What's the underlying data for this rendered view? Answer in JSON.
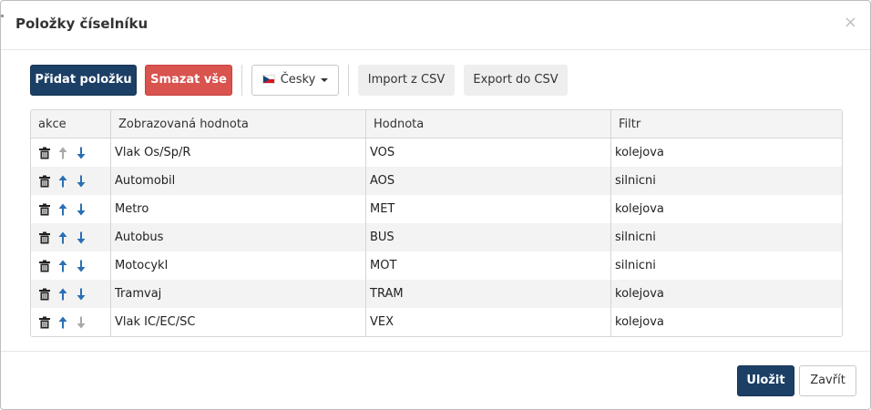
{
  "dialog": {
    "title": "Položky číselníku",
    "close_glyph": "×"
  },
  "toolbar": {
    "add_label": "Přidat položku",
    "delete_all_label": "Smazat vše",
    "language_label": "Česky",
    "import_label": "Import z CSV",
    "export_label": "Export do CSV"
  },
  "table": {
    "columns": [
      "akce",
      "Zobrazovaná hodnota",
      "Hodnota",
      "Filtr"
    ],
    "rows": [
      {
        "display": "Vlak Os/Sp/R",
        "value": "VOS",
        "filter": "kolejova",
        "up_enabled": false,
        "down_enabled": true
      },
      {
        "display": "Automobil",
        "value": "AOS",
        "filter": "silnicni",
        "up_enabled": true,
        "down_enabled": true
      },
      {
        "display": "Metro",
        "value": "MET",
        "filter": "kolejova",
        "up_enabled": true,
        "down_enabled": true
      },
      {
        "display": "Autobus",
        "value": "BUS",
        "filter": "silnicni",
        "up_enabled": true,
        "down_enabled": true
      },
      {
        "display": "Motocykl",
        "value": "MOT",
        "filter": "silnicni",
        "up_enabled": true,
        "down_enabled": true
      },
      {
        "display": "Tramvaj",
        "value": "TRAM",
        "filter": "kolejova",
        "up_enabled": true,
        "down_enabled": true
      },
      {
        "display": "Vlak IC/EC/SC",
        "value": "VEX",
        "filter": "kolejova",
        "up_enabled": true,
        "down_enabled": false
      }
    ],
    "row_icons": [
      "trash-icon",
      "arrow-up-icon",
      "arrow-down-icon"
    ]
  },
  "footer": {
    "save_label": "Uložit",
    "close_label": "Zavřít"
  },
  "colors": {
    "primary": "#1c3f66",
    "danger": "#d9534f",
    "arrow_enabled": "#2a6fb5",
    "arrow_disabled": "#a9a9a9"
  }
}
